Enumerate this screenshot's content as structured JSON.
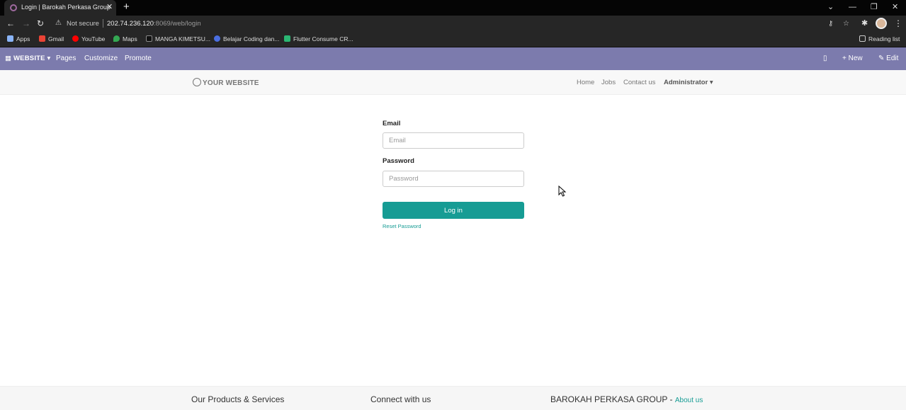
{
  "browser": {
    "tab_title": "Login | Barokah Perkasa Group",
    "not_secure": "Not secure",
    "url_host": "202.74.236.120",
    "url_path": ":8069/web/login",
    "bookmarks": [
      "Apps",
      "Gmail",
      "YouTube",
      "Maps",
      "MANGA KIMETSU...",
      "Belajar Coding dan...",
      "Flutter Consume CR..."
    ],
    "reading_list": "Reading list"
  },
  "odoo_bar": {
    "website": "WEBSITE",
    "pages": "Pages",
    "customize": "Customize",
    "promote": "Promote",
    "new": "New",
    "edit": "Edit"
  },
  "header": {
    "logo": "YOUR WEBSITE",
    "nav": [
      "Home",
      "Jobs",
      "Contact us"
    ],
    "user": "Administrator"
  },
  "form": {
    "email_label": "Email",
    "email_placeholder": "Email",
    "password_label": "Password",
    "password_placeholder": "Password",
    "login_button": "Log in",
    "reset_link": "Reset Password"
  },
  "footer": {
    "col1": "Our Products & Services",
    "col2": "Connect with us",
    "col3": "BAROKAH PERKASA GROUP",
    "col3_sep": " - ",
    "col3_link": "About us"
  }
}
